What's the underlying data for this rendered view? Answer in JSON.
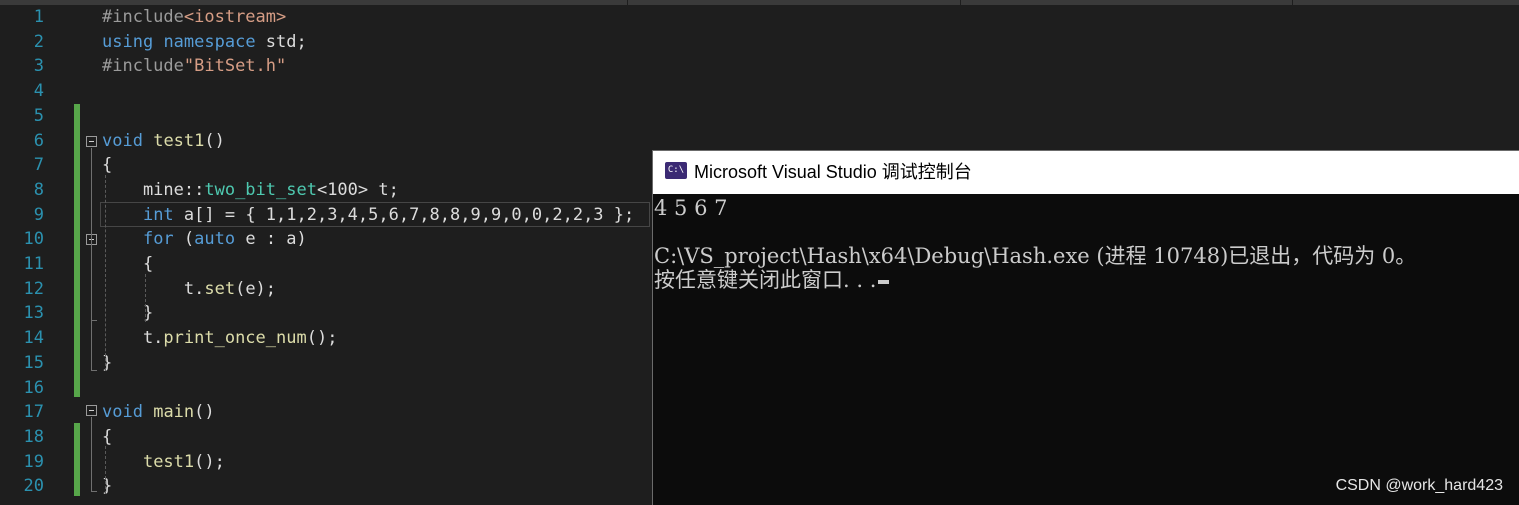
{
  "editor": {
    "line_numbers": [
      "1",
      "2",
      "3",
      "4",
      "5",
      "6",
      "7",
      "8",
      "9",
      "10",
      "11",
      "12",
      "13",
      "14",
      "15",
      "16",
      "17",
      "18",
      "19",
      "20"
    ],
    "lines": [
      {
        "tokens": [
          {
            "t": "#include",
            "c": "pp"
          },
          {
            "t": "<iostream>",
            "c": "str"
          }
        ]
      },
      {
        "tokens": [
          {
            "t": "using",
            "c": "kw"
          },
          {
            "t": " ",
            "c": ""
          },
          {
            "t": "namespace",
            "c": "kw"
          },
          {
            "t": " std;",
            "c": ""
          }
        ]
      },
      {
        "tokens": [
          {
            "t": "#include",
            "c": "pp"
          },
          {
            "t": "\"BitSet.h\"",
            "c": "str"
          }
        ]
      },
      {
        "tokens": []
      },
      {
        "tokens": []
      },
      {
        "tokens": [
          {
            "t": "void",
            "c": "kw"
          },
          {
            "t": " ",
            "c": ""
          },
          {
            "t": "test1",
            "c": "fn"
          },
          {
            "t": "()",
            "c": ""
          }
        ]
      },
      {
        "tokens": [
          {
            "t": "{",
            "c": ""
          }
        ]
      },
      {
        "tokens": [
          {
            "t": "    mine::",
            "c": ""
          },
          {
            "t": "two_bit_set",
            "c": "ns"
          },
          {
            "t": "<100> t;",
            "c": ""
          }
        ]
      },
      {
        "tokens": [
          {
            "t": "    ",
            "c": ""
          },
          {
            "t": "int",
            "c": "kw"
          },
          {
            "t": " a[] = { 1,1,2,3,4,5,6,7,8,8,9,9,0,0,2,2,3 };",
            "c": ""
          }
        ]
      },
      {
        "tokens": [
          {
            "t": "    ",
            "c": ""
          },
          {
            "t": "for",
            "c": "kw"
          },
          {
            "t": " (",
            "c": ""
          },
          {
            "t": "auto",
            "c": "kw"
          },
          {
            "t": " e : a)",
            "c": ""
          }
        ]
      },
      {
        "tokens": [
          {
            "t": "    {",
            "c": ""
          }
        ]
      },
      {
        "tokens": [
          {
            "t": "        t.",
            "c": ""
          },
          {
            "t": "set",
            "c": "fn"
          },
          {
            "t": "(e);",
            "c": ""
          }
        ]
      },
      {
        "tokens": [
          {
            "t": "    }",
            "c": ""
          }
        ]
      },
      {
        "tokens": [
          {
            "t": "    t.",
            "c": ""
          },
          {
            "t": "print_once_num",
            "c": "fn"
          },
          {
            "t": "();",
            "c": ""
          }
        ]
      },
      {
        "tokens": [
          {
            "t": "}",
            "c": ""
          }
        ]
      },
      {
        "tokens": []
      },
      {
        "tokens": [
          {
            "t": "void",
            "c": "kw"
          },
          {
            "t": " ",
            "c": ""
          },
          {
            "t": "main",
            "c": "fn"
          },
          {
            "t": "()",
            "c": ""
          }
        ]
      },
      {
        "tokens": [
          {
            "t": "{",
            "c": ""
          }
        ]
      },
      {
        "tokens": [
          {
            "t": "    ",
            "c": ""
          },
          {
            "t": "test1",
            "c": "fn"
          },
          {
            "t": "();",
            "c": ""
          }
        ]
      },
      {
        "tokens": [
          {
            "t": "}",
            "c": ""
          }
        ]
      }
    ]
  },
  "console": {
    "title": "Microsoft Visual Studio 调试控制台",
    "icon_text": "C:\\",
    "icon": "console-window-icon",
    "output_lines": [
      "4 5 6 7",
      "",
      "C:\\VS_project\\Hash\\x64\\Debug\\Hash.exe (进程 10748)已退出，代码为 0。",
      "按任意键关闭此窗口. . ."
    ]
  },
  "watermark": "CSDN @work_hard423",
  "colors": {
    "background": "#1e1e1e",
    "keyword": "#569cd6",
    "function": "#dcdcaa",
    "string": "#d69d85",
    "line_number": "#2b91af",
    "change_bar": "#57a64a",
    "console_bg": "#0c0c0c"
  }
}
